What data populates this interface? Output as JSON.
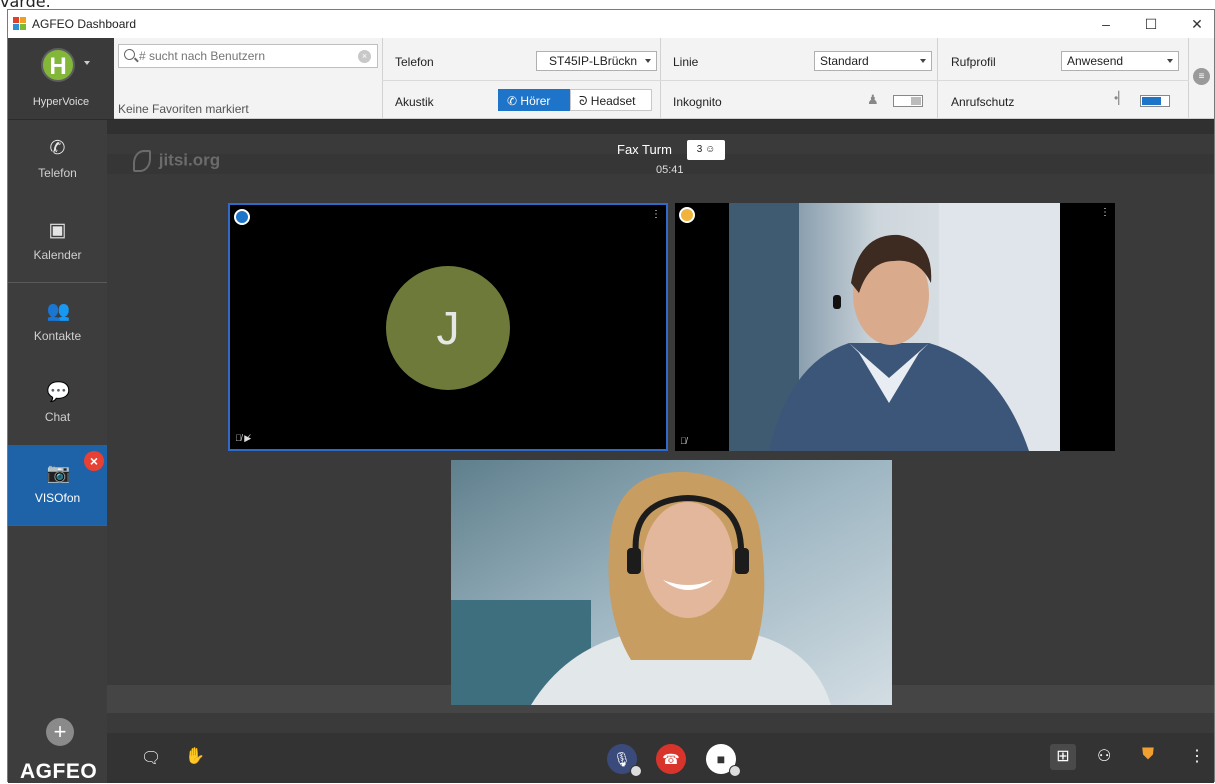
{
  "top_cut_text": "varde.",
  "window": {
    "title": "AGFEO Dashboard",
    "minimize": "–",
    "maximize": "☐",
    "close": "✕"
  },
  "user": {
    "initial": "H",
    "name": "HyperVoice"
  },
  "search": {
    "placeholder": "# sucht nach Benutzern"
  },
  "favorites_text": "Keine Favoriten markiert",
  "telefon": {
    "label": "Telefon",
    "value": "ST45IP-LBrückn"
  },
  "linie": {
    "label": "Linie",
    "value": "Standard"
  },
  "rufprofil": {
    "label": "Rufprofil",
    "value": "Anwesend"
  },
  "akustik": {
    "label": "Akustik",
    "options": [
      "Hörer",
      "Headset"
    ],
    "selected": "Hörer"
  },
  "inkognito": {
    "label": "Inkognito",
    "on": false
  },
  "anrufschutz": {
    "label": "Anrufschutz",
    "on": true
  },
  "nav": {
    "telefon": "Telefon",
    "kalender": "Kalender",
    "kontakte": "Kontakte",
    "chat": "Chat",
    "visofon": "VISOfon",
    "active": "VISOfon"
  },
  "brand": "AGFEO",
  "meeting": {
    "watermark": "jitsi.org",
    "name": "Fax Turm",
    "participants": "3",
    "timer": "05:41",
    "initial": "J"
  },
  "colors": {
    "accent": "#1e74c8",
    "hangup": "#d8342b",
    "badge": "#e84133",
    "avatar": "#83b73a"
  }
}
